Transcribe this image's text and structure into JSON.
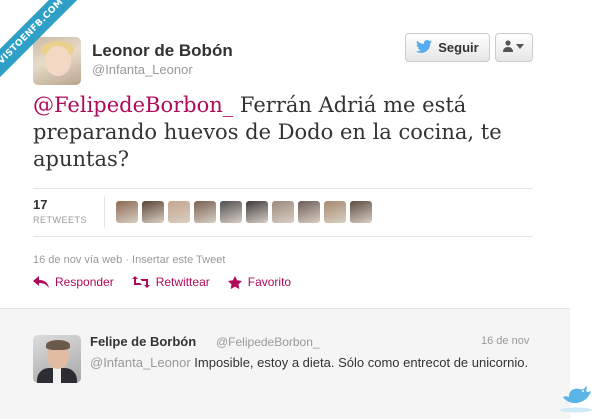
{
  "ribbon": {
    "text": "VISTOENFB.COM"
  },
  "tweet": {
    "user_name": "Leonor de Bobón",
    "user_handle": "@Infanta_Leonor",
    "follow_label": "Seguir",
    "text_mention": "@FelipedeBorbon_",
    "text_body": " Ferrán Adriá me está preparando huevos de Dodo en la cocina, te apuntas?",
    "retweets_count": "17",
    "retweets_label": "RETWEETS",
    "meta": "16 de nov vía web · Insertar este Tweet",
    "actions": {
      "reply": "Responder",
      "retweet": "Retwittear",
      "favorite": "Favorito"
    },
    "retweeter_avatar_colors": [
      "#8c6a52",
      "#5b4536",
      "#c4a48c",
      "#7a6152",
      "#4f4f4f",
      "#3b3b3b",
      "#9c8a7c",
      "#6b5d57",
      "#a78a6c",
      "#5d4c40"
    ]
  },
  "reply": {
    "user_name": "Felipe de Borbón",
    "user_handle": "@FelipedeBorbon_",
    "time": "16 de nov",
    "text_mention": "@Infanta_Leonor",
    "text_body": " Imposible, estoy a dieta. Sólo como entrecot de unicornio."
  },
  "colors": {
    "accent": "#b00a5a",
    "muted": "#999999",
    "ribbon": "#2ea0c8",
    "bird": "#5ab4e6"
  }
}
